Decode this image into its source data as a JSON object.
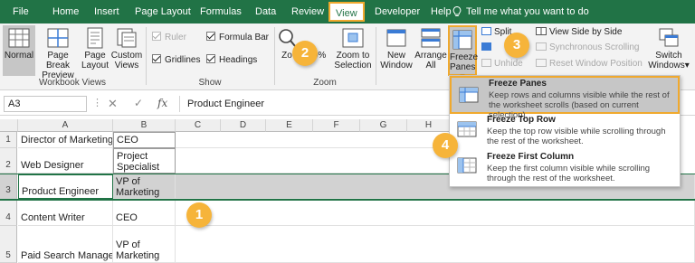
{
  "menu": {
    "tabs": [
      "File",
      "Home",
      "Insert",
      "Page Layout",
      "Formulas",
      "Data",
      "Review",
      "View",
      "Developer",
      "Help"
    ],
    "tellme": "Tell me what you want to do"
  },
  "ribbon": {
    "workbook_views": {
      "normal": "Normal",
      "page_break_1": "Page Break",
      "page_break_2": "Preview",
      "page_layout_1": "Page",
      "page_layout_2": "Layout",
      "custom_views_1": "Custom",
      "custom_views_2": "Views",
      "group_label": "Workbook Views"
    },
    "show": {
      "ruler": "Ruler",
      "formula_bar": "Formula Bar",
      "gridlines": "Gridlines",
      "headings": "Headings",
      "group_label": "Show"
    },
    "zoom": {
      "zoom": "Zo",
      "hundred": "0%",
      "zoom_to_selection_1": "Zoom to",
      "zoom_to_selection_2": "Selection",
      "group_label": "Zoom"
    },
    "window": {
      "new_window_1": "New",
      "new_window_2": "Window",
      "arrange_all_1": "Arrange",
      "arrange_all_2": "All",
      "freeze_panes_1": "Freeze",
      "freeze_panes_2": "Panes",
      "split": "Split",
      "hide": "",
      "unhide": "Unhide",
      "view_side_by_side": "View Side by Side",
      "synchronous_scrolling": "Synchronous Scrolling",
      "reset_window_position": "Reset Window Position",
      "switch_windows_1": "Switch",
      "switch_windows_2": "Windows"
    }
  },
  "formula_bar": {
    "name_box": "A3",
    "value": "Product Engineer"
  },
  "grid": {
    "columns": [
      "A",
      "B",
      "C",
      "D",
      "E",
      "F",
      "G",
      "H"
    ],
    "rows": [
      {
        "num": "1",
        "a": "Director of Marketing",
        "b": "CEO"
      },
      {
        "num": "2",
        "a": "Web Designer",
        "b1": "Project",
        "b2": "Specialist"
      },
      {
        "num": "3",
        "a": "Product Engineer",
        "b1": "VP of",
        "b2": "Marketing"
      },
      {
        "num": "4",
        "a": "Content Writer",
        "b": "CEO"
      },
      {
        "num": "5",
        "a": "Paid Search Manager",
        "b1": "VP of",
        "b2": "Marketing"
      }
    ]
  },
  "freeze_menu": [
    {
      "title": "Freeze Panes",
      "desc": "Keep rows and columns visible while the rest of the worksheet scrolls (based on current selection)."
    },
    {
      "title": "Freeze Top Row",
      "desc": "Keep the top row visible while scrolling through the rest of the worksheet."
    },
    {
      "title": "Freeze First Column",
      "desc": "Keep the first column visible while scrolling through the rest of the worksheet."
    }
  ],
  "callouts": [
    "1",
    "2",
    "3",
    "4"
  ],
  "colors": {
    "excel_green": "#217346",
    "callout_orange": "#f6b43a",
    "highlight_border": "#f0a92e"
  }
}
